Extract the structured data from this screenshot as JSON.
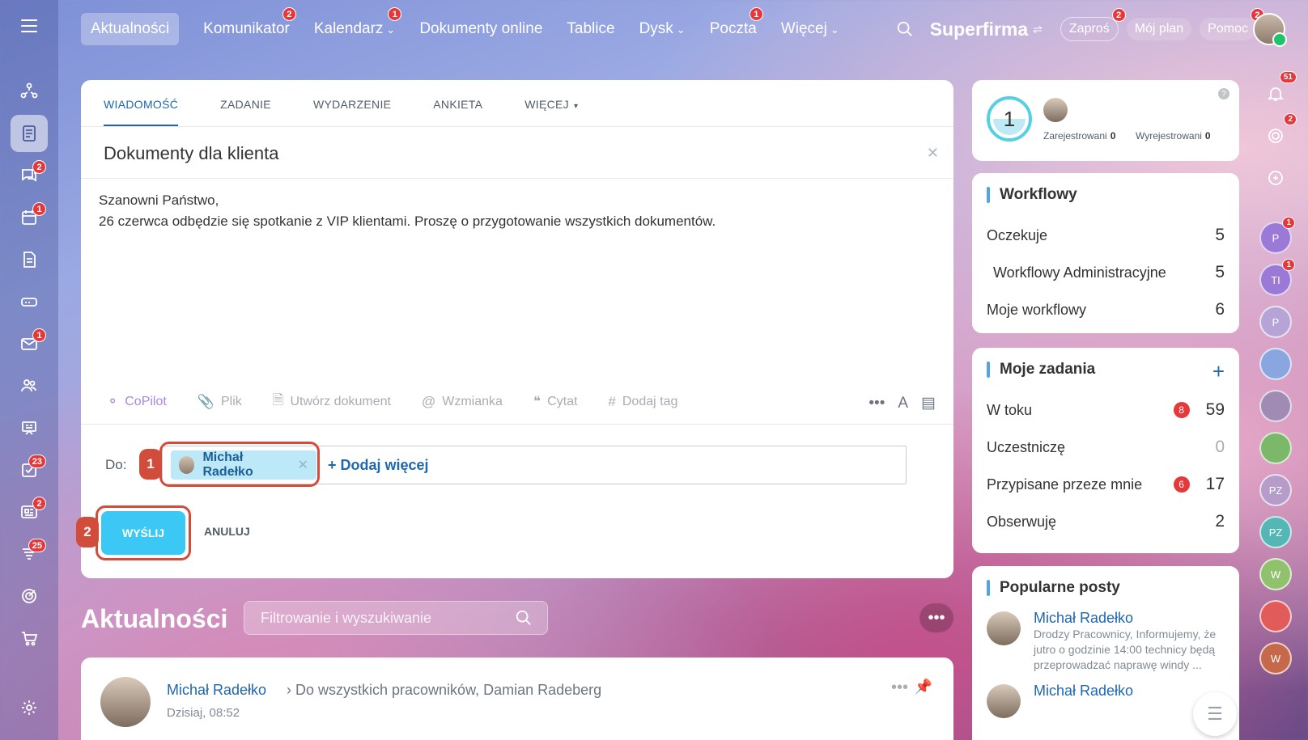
{
  "topnav": {
    "items": [
      {
        "label": "Aktualności",
        "badge": ""
      },
      {
        "label": "Komunikator",
        "badge": "2"
      },
      {
        "label": "Kalendarz",
        "badge": "1"
      },
      {
        "label": "Dokumenty online",
        "badge": ""
      },
      {
        "label": "Tablice",
        "badge": ""
      },
      {
        "label": "Dysk",
        "badge": ""
      },
      {
        "label": "Poczta",
        "badge": "1"
      },
      {
        "label": "Więcej",
        "badge": ""
      }
    ],
    "brand": "Superfirma",
    "invite": "Zaproś",
    "invite_badge": "2",
    "my_plan": "Mój plan",
    "help": "Pomoc",
    "help_badge": "2"
  },
  "sidebar": {
    "badges": {
      "chat": "2",
      "calendar": "1",
      "mail": "1",
      "tasks": "23",
      "news": "2",
      "crm": "25"
    }
  },
  "composer": {
    "tabs": [
      "WIADOMOŚĆ",
      "ZADANIE",
      "WYDARZENIE",
      "ANKIETA",
      "WIĘCEJ"
    ],
    "title": "Dokumenty dla klienta",
    "body_line1": "Szanowni Państwo,",
    "body_line2": "26 czerwca odbędzie się spotkanie z VIP klientami. Proszę o przygotowanie wszystkich dokumentów.",
    "tools": {
      "copilot": "CoPilot",
      "file": "Plik",
      "create_doc": "Utwórz dokument",
      "mention": "Wzmianka",
      "quote": "Cytat",
      "tag": "Dodaj tag"
    },
    "to_label": "Do:",
    "recipient": "Michał Radełko",
    "add_more": "Dodaj więcej",
    "send": "WYŚLIJ",
    "cancel": "ANULUJ",
    "step1": "1",
    "step2": "2"
  },
  "feed": {
    "title": "Aktualności",
    "search_placeholder": "Filtrowanie i wyszukiwanie",
    "post": {
      "author": "Michał Radełko",
      "to": "Do wszystkich pracowników, Damian Radeberg",
      "time": "Dzisiaj, 08:52"
    }
  },
  "widgets": {
    "timeman": {
      "count": "1",
      "registered_label": "Zarejestrowani",
      "registered_value": "0",
      "unregistered_label": "Wyrejestrowani",
      "unregistered_value": "0"
    },
    "workflows": {
      "title": "Workflowy",
      "rows": [
        {
          "label": "Oczekuje",
          "value": "5"
        },
        {
          "label": "Workflowy Administracyjne",
          "value": "5"
        },
        {
          "label": "Moje workflowy",
          "value": "6"
        }
      ]
    },
    "tasks": {
      "title": "Moje zadania",
      "rows": [
        {
          "label": "W toku",
          "badge": "8",
          "value": "59"
        },
        {
          "label": "Uczestniczę",
          "badge": "",
          "value": "0"
        },
        {
          "label": "Przypisane przeze mnie",
          "badge": "6",
          "value": "17"
        },
        {
          "label": "Obserwuję",
          "badge": "",
          "value": "2"
        }
      ]
    },
    "popular": {
      "title": "Popularne posty",
      "items": [
        {
          "author": "Michał Radełko",
          "text": "Drodzy Pracownicy, Informujemy, że jutro o godzinie 14:00 technicy będą przeprowadzać naprawę windy ..."
        },
        {
          "author": "Michał Radełko",
          "text": ""
        }
      ]
    }
  },
  "rail": {
    "notifications_badge": "51",
    "activity_badge": "2",
    "chats": [
      {
        "initials": "P",
        "badge": "1",
        "color": "#9a7ad6"
      },
      {
        "initials": "TI",
        "badge": "1",
        "color": "#9a7ad6"
      },
      {
        "initials": "P",
        "badge": "",
        "color": "#b6a4d6"
      },
      {
        "initials": "",
        "badge": "",
        "color": "#8aa6e0"
      },
      {
        "initials": "",
        "badge": "",
        "color": "#a08bb5"
      },
      {
        "initials": "",
        "badge": "",
        "color": "#7cb86a"
      },
      {
        "initials": "PZ",
        "badge": "",
        "color": "#b59cc9"
      },
      {
        "initials": "PZ",
        "badge": "",
        "color": "#55b6b6"
      },
      {
        "initials": "W",
        "badge": "",
        "color": "#90c26d"
      },
      {
        "initials": "",
        "badge": "",
        "color": "#e25b5b"
      },
      {
        "initials": "W",
        "badge": "",
        "color": "#c5694a"
      }
    ]
  }
}
